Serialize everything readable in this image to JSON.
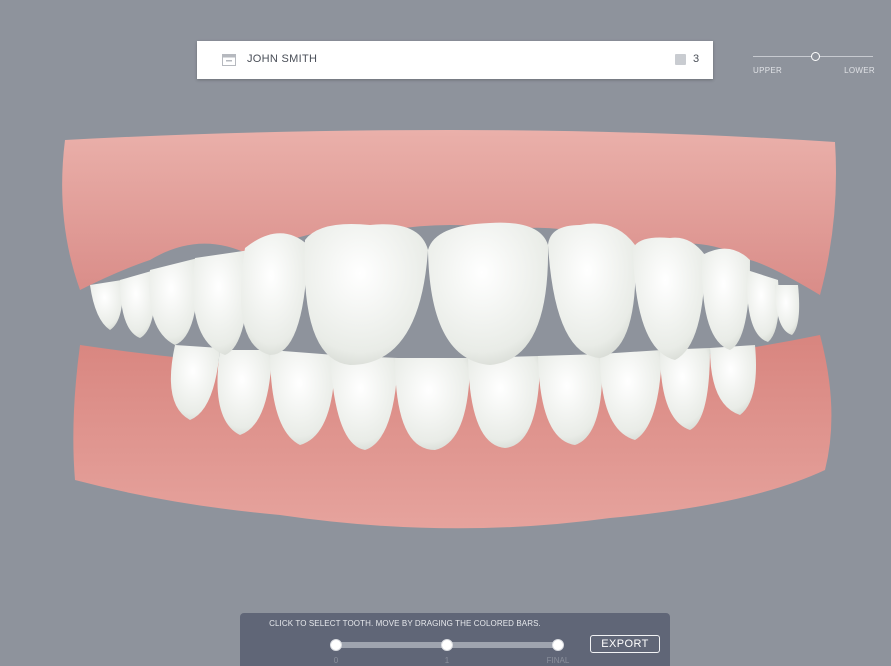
{
  "patient": {
    "name": "JOHN SMITH",
    "stage_count": "3",
    "icon": "folder-icon",
    "stage_icon": "square-icon"
  },
  "jaw_view": {
    "upper_label": "UPPER",
    "lower_label": "LOWER",
    "position": 0.5
  },
  "controls": {
    "instructions": "CLICK TO SELECT TOOTH. MOVE BY DRAGING THE COLORED BARS.",
    "stages": [
      "0",
      "1",
      "FINAL"
    ],
    "export_label": "EXPORT"
  },
  "colors": {
    "background": "#8e939c",
    "gum": "#e39c98",
    "tooth": "#ecefea",
    "panel": "#606677"
  }
}
